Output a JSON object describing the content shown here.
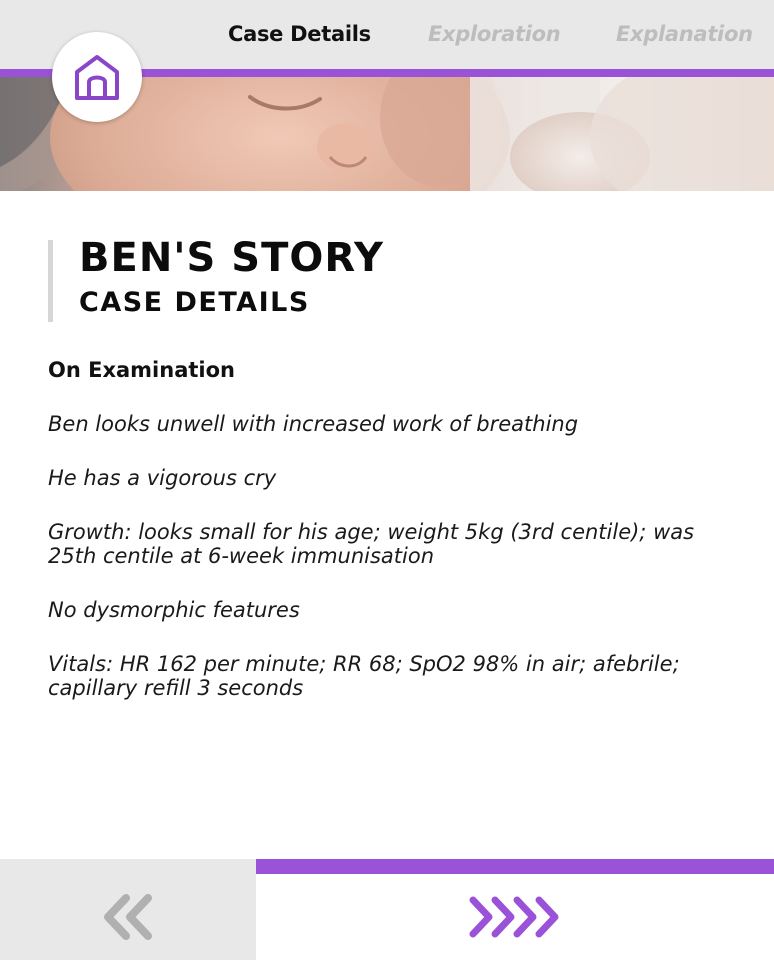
{
  "nav": {
    "tabs": [
      {
        "label": "Case Details",
        "active": true
      },
      {
        "label": "Exploration",
        "active": false
      },
      {
        "label": "Explanation",
        "active": false
      }
    ],
    "accent_color": "#9a52d8"
  },
  "home": {
    "icon": "home-icon"
  },
  "hero": {
    "image": "sleeping-baby-photo"
  },
  "story": {
    "title": "BEN'S STORY",
    "subtitle": "CASE DETAILS"
  },
  "examination": {
    "heading": "On Examination",
    "paragraphs": [
      "Ben looks unwell with increased work of breathing",
      "He has a vigorous cry",
      "Growth: looks small for his age; weight 5kg (3rd centile); was 25th centile at 6-week immunisation",
      "No dysmorphic features",
      "Vitals: HR 162 per minute; RR 68; SpO2 98% in air; afebrile; capillary refill 3 seconds"
    ]
  },
  "footer": {
    "prev_icon": "double-chevron-left-icon",
    "next_icon": "quadruple-chevron-right-icon"
  }
}
